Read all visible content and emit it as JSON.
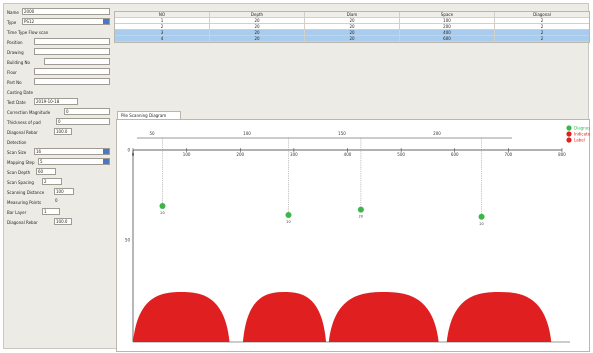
{
  "left_panel": {
    "name_label": "Name",
    "name_value": "2000",
    "type_label": "Type",
    "type_value": "PS12",
    "tower_label": "Time Type Flow scan",
    "position_label": "Position",
    "drawing_label": "Drawing",
    "building_label": "Building No",
    "floor_label": "Floor",
    "part_label": "Part No",
    "casting_label": "Casting Date",
    "test_date_label": "Test Date",
    "test_date_value": "2019-10-18",
    "correction_label": "Correction Magnitude",
    "correction_value": "0",
    "thickness_label": "Thickness of pad",
    "thickness_value": "0",
    "rebar_diam_label": "Diagonal Rebar",
    "rebar_diam_value": "100.0",
    "detection_label": "Detection",
    "scan_size_label": "Scan Size",
    "scan_size_value": "16",
    "mapping_label": "Mapping Step",
    "mapping_value": "5",
    "scan_depth_label": "Scan Depth",
    "scan_depth_value": "60",
    "scan_spacing_label": "Scan Spacing",
    "scan_spacing_value": "2",
    "scanning_distance_label": "Scanning Distance",
    "scanning_distance_value": "100",
    "measuring_points_label": "Measuring Points",
    "measuring_points_value": "0",
    "bar_layer_label": "Bar Layer",
    "bar_layer_value": "1",
    "rebar_pos_label": "Diagonal Rebar",
    "rebar_pos_value": "100.0"
  },
  "table": {
    "headers": [
      "NO",
      "Depth",
      "Diam",
      "Space",
      "Diagonal"
    ],
    "rows": [
      [
        "1",
        "20",
        "20",
        "100",
        "2"
      ],
      [
        "2",
        "20",
        "20",
        "200",
        "2"
      ],
      [
        "3",
        "20",
        "20",
        "400",
        "2"
      ],
      [
        "4",
        "20",
        "20",
        "600",
        "2"
      ]
    ],
    "selected_rows": [
      2,
      3
    ]
  },
  "graph": {
    "tab_label": "Pile Scanning Diagram",
    "top_ticks": [
      "50",
      "100",
      "150",
      "200"
    ],
    "mid_ticks": [
      "0",
      "100",
      "200",
      "300",
      "400",
      "500",
      "600",
      "700",
      "800"
    ],
    "y_ticks": [
      "0",
      "50"
    ],
    "legend": [
      {
        "label": "Diagnos",
        "color": "#3cb64a"
      },
      {
        "label": "Indicate",
        "color": "#e02020"
      },
      {
        "label": "Label",
        "color": "#e02020"
      }
    ],
    "rebars": [
      {
        "x": 55,
        "depth": 20,
        "label": "20"
      },
      {
        "x": 290,
        "depth": 25,
        "label": "20"
      },
      {
        "x": 425,
        "depth": 22,
        "label": "20"
      },
      {
        "x": 650,
        "depth": 26,
        "label": "20"
      }
    ],
    "humps": [
      {
        "x0": 0,
        "x1": 180
      },
      {
        "x0": 205,
        "x1": 360
      },
      {
        "x0": 365,
        "x1": 570
      },
      {
        "x0": 585,
        "x1": 780
      }
    ],
    "colors": {
      "rebar": "#3cb64a",
      "signal": "#e02020",
      "axis": "#333333",
      "guide": "#888888"
    }
  }
}
